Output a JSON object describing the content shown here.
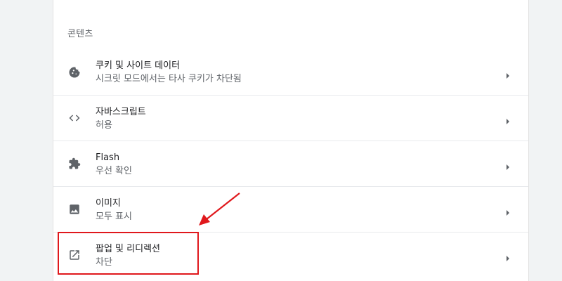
{
  "section": {
    "title": "콘텐츠"
  },
  "rows": [
    {
      "label": "쿠키 및 사이트 데이터",
      "sublabel": "시크릿 모드에서는 타사 쿠키가 차단됨",
      "icon": "cookie-icon"
    },
    {
      "label": "자바스크립트",
      "sublabel": "허용",
      "icon": "code-icon"
    },
    {
      "label": "Flash",
      "sublabel": "우선 확인",
      "icon": "puzzle-icon"
    },
    {
      "label": "이미지",
      "sublabel": "모두 표시",
      "icon": "image-icon"
    },
    {
      "label": "팝업 및 리디렉션",
      "sublabel": "차단",
      "icon": "open-in-new-icon"
    }
  ],
  "annotation": {
    "highlight_color": "#e0181c"
  }
}
